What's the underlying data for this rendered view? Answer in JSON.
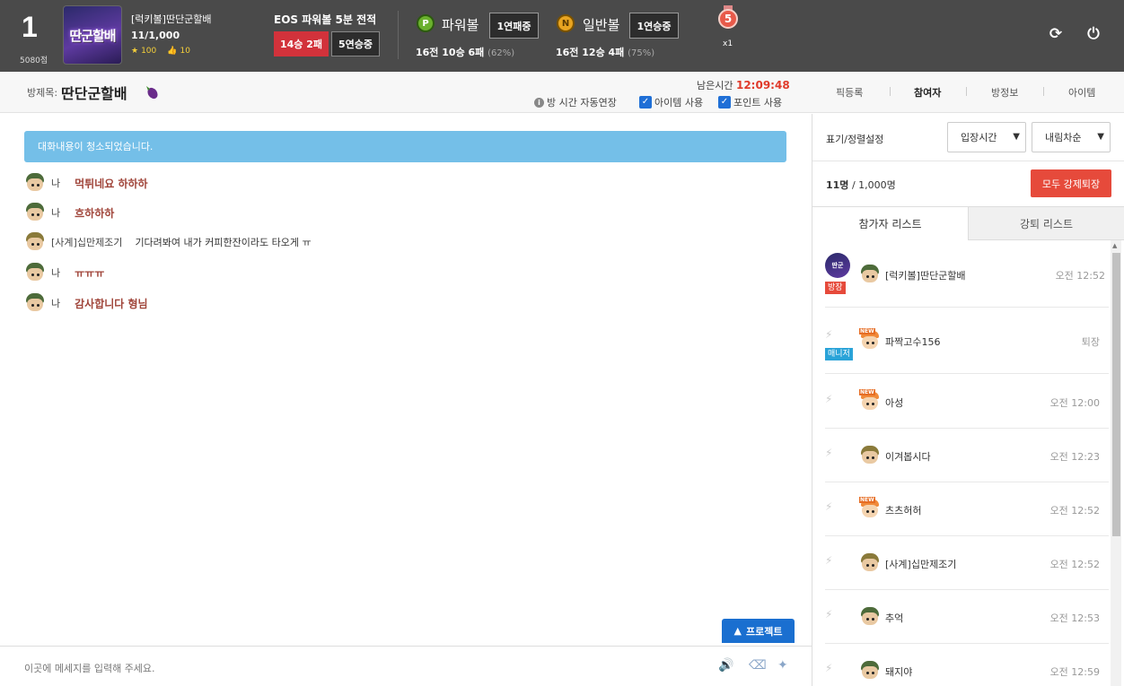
{
  "header": {
    "rank": "1",
    "rank_points": "5080점",
    "logo_text": "딴군할배",
    "user_name": "[럭키볼]딴단군할배",
    "user_count": "11/1,000",
    "stars": "100",
    "likes": "10",
    "eos_title": "EOS 파워볼 5분 전적",
    "eos_record": "14승 2패",
    "eos_streak": "5연승중",
    "powerball": {
      "icon": "P",
      "label": "파워볼",
      "streak": "1연패중",
      "record": "16전 10승 6패",
      "pct": "(62%)"
    },
    "normalball": {
      "icon": "N",
      "label": "일반볼",
      "streak": "1연승중",
      "record": "16전 12승 4패",
      "pct": "(75%)"
    },
    "medal_num": "5",
    "medal_count": "x1"
  },
  "room": {
    "label": "방제목:",
    "title": "딴단군할배",
    "remain_label": "남은시간",
    "remain_time": "12:09:48",
    "option_extend": "방 시간 자동연장",
    "option_item": "아이템 사용",
    "option_point": "포인트 사용",
    "tabs": [
      "픽등록",
      "참여자",
      "방정보",
      "아이템"
    ]
  },
  "chat": {
    "notice": "대화내용이 청소되었습니다.",
    "messages": [
      {
        "nick": "나",
        "text": "먹튀네요 하하하"
      },
      {
        "nick": "나",
        "text": "흐하하하"
      },
      {
        "nick": "[사계]십만제조기",
        "text": "기다려봐여 내가 커피한잔이라도 타오게 ㅠ"
      },
      {
        "nick": "나",
        "text": "ㅠㅠㅠ"
      },
      {
        "nick": "나",
        "text": "감사합니다 형님"
      }
    ],
    "project_button": "프로젝트",
    "input_placeholder": "이곳에 메세지를 입력해 주세요."
  },
  "panel": {
    "sort_label": "표기/정렬설정",
    "sort_by": "입장시간",
    "sort_order": "내림차순",
    "count_current": "11명",
    "count_max": "/ 1,000명",
    "kick_all": "모두 강제퇴장",
    "tab_participants": "참가자 리스트",
    "tab_kicked": "강퇴 리스트",
    "participants": [
      {
        "name": "[럭키볼]딴단군할배",
        "time": "오전 12:52",
        "badge": "방장"
      },
      {
        "name": "파짝고수156",
        "time": "퇴장",
        "badge": "매니저"
      },
      {
        "name": "아성",
        "time": "오전 12:00",
        "badge": ""
      },
      {
        "name": "이겨봅시다",
        "time": "오전 12:23",
        "badge": ""
      },
      {
        "name": "츠츠허허",
        "time": "오전 12:52",
        "badge": ""
      },
      {
        "name": "[사계]십만제조기",
        "time": "오전 12:52",
        "badge": ""
      },
      {
        "name": "추억",
        "time": "오전 12:53",
        "badge": ""
      },
      {
        "name": "돼지야",
        "time": "오전 12:59",
        "badge": ""
      }
    ]
  }
}
